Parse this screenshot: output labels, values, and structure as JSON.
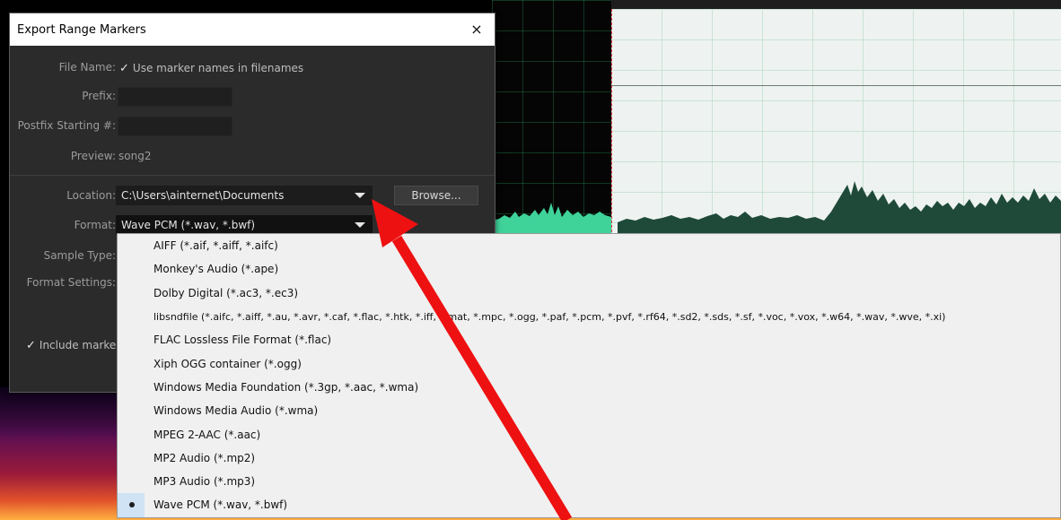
{
  "dialog": {
    "title": "Export Range Markers",
    "close_icon": "×",
    "file_name_label": "File Name:",
    "use_marker_names_label": "Use marker names in filenames",
    "prefix_label": "Prefix:",
    "postfix_label": "Postfix Starting #:",
    "preview_label": "Preview:",
    "preview_value": "song2",
    "location_label": "Location:",
    "location_value": "C:\\Users\\ainternet\\Documents",
    "browse_label": "Browse...",
    "format_label": "Format:",
    "format_value": "Wave PCM (*.wav, *.bwf)",
    "sample_type_label": "Sample Type:",
    "format_settings_label": "Format Settings:",
    "include_markers_label": "Include marker"
  },
  "format_options": [
    "AIFF (*.aif, *.aiff, *.aifc)",
    "Monkey's Audio (*.ape)",
    "Dolby Digital (*.ac3, *.ec3)",
    "libsndfile (*.aifc, *.aiff, *.au, *.avr, *.caf, *.flac, *.htk, *.iff, *.mat, *.mpc, *.ogg, *.paf, *.pcm, *.pvf, *.rf64, *.sd2, *.sds, *.sf, *.voc, *.vox, *.w64, *.wav, *.wve, *.xi)",
    "FLAC Lossless File Format (*.flac)",
    "Xiph OGG container (*.ogg)",
    "Windows Media Foundation (*.3gp, *.aac, *.wma)",
    "Windows Media Audio (*.wma)",
    "MPEG 2-AAC (*.aac)",
    "MP2 Audio (*.mp2)",
    "MP3 Audio (*.mp3)",
    "Wave PCM (*.wav, *.bwf)"
  ],
  "selected_format_index": 11,
  "colors": {
    "dialog_bg": "#2b2b2b",
    "waveform": "#3fd39a",
    "waveform_dark": "#1f4a3a",
    "arrow": "#ee1111",
    "selection_bg": "#eef3f1"
  },
  "icons": {
    "close": "close-icon",
    "dropdown": "chevron-down-icon",
    "checkbox": "checkmark-icon",
    "annotation": "arrow-annotation"
  }
}
